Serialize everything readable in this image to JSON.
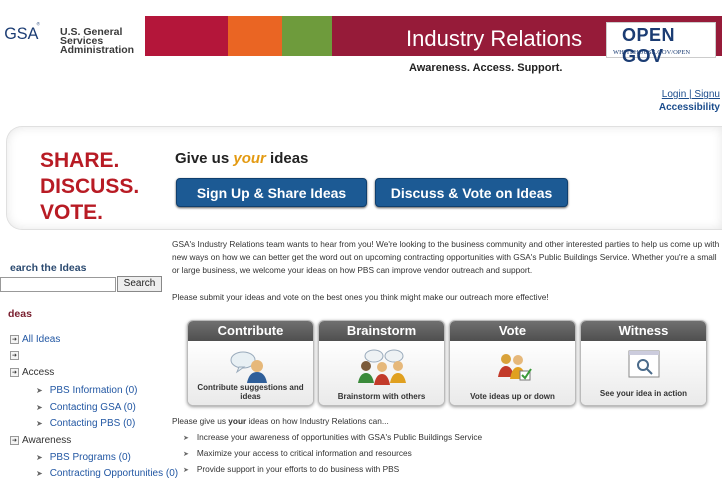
{
  "header": {
    "org_abbr": "GSA",
    "org_name_line1": "U.S. General",
    "org_name_line2": "Services",
    "org_name_line3": "Administration",
    "site_title": "Industry Relations",
    "tagline": "Awareness. Access. Support.",
    "opengov_label": "OPEN GOV",
    "opengov_url": "WHITEHOUSE.GOV/OPEN"
  },
  "account": {
    "login_signup": "Login | Signu",
    "accessibility": "Accessibility"
  },
  "promo": {
    "slogan_line1": "SHARE.",
    "slogan_line2": "DISCUSS.",
    "slogan_line3": "VOTE.",
    "give_prefix": "Give us ",
    "give_your": "your",
    "give_suffix": " ideas",
    "signup_button": "Sign Up & Share Ideas",
    "discuss_button": "Discuss & Vote on Ideas"
  },
  "sidebar": {
    "search_title": "earch the Ideas",
    "search_value": "",
    "search_button": "Search",
    "ideas_title": "deas",
    "all_ideas": "All Ideas",
    "blank_item": "",
    "categories": [
      {
        "label": "Access",
        "items": [
          "PBS Information (0)",
          "Contacting GSA (0)",
          "Contacting PBS (0)"
        ]
      },
      {
        "label": "Awareness",
        "items": [
          "PBS Programs (0)",
          "Contracting Opportunities (0)"
        ]
      }
    ]
  },
  "main": {
    "intro": "GSA's Industry Relations team wants to hear from you! We're looking to the business community and other interested parties to help us come up with new ways on how we can better get the word out on upcoming contracting opportunities with GSA's Public Buildings Service. Whether you're a small or large business, we welcome your ideas on how PBS can improve vendor outreach and support.",
    "submit_text": "Please submit your ideas and vote on the best ones you think might make our outreach more effective!",
    "cards": [
      {
        "title": "Contribute",
        "caption": "Contribute suggestions and ideas",
        "icon": "speech-bubble-person-icon"
      },
      {
        "title": "Brainstorm",
        "caption": "Brainstorm with others",
        "icon": "group-thinking-icon"
      },
      {
        "title": "Vote",
        "caption": "Vote ideas up or down",
        "icon": "vote-people-icon"
      },
      {
        "title": "Witness",
        "caption": "See your idea in action",
        "icon": "magnifier-window-icon"
      }
    ],
    "please_prefix": "Please give us ",
    "please_your": "your",
    "please_suffix": " ideas on how Industry Relations can...",
    "list": [
      "Increase your awareness of opportunities with GSA's Public Buildings Service",
      "Maximize your access to critical information and resources",
      "Provide support in your efforts to do business with PBS"
    ]
  }
}
